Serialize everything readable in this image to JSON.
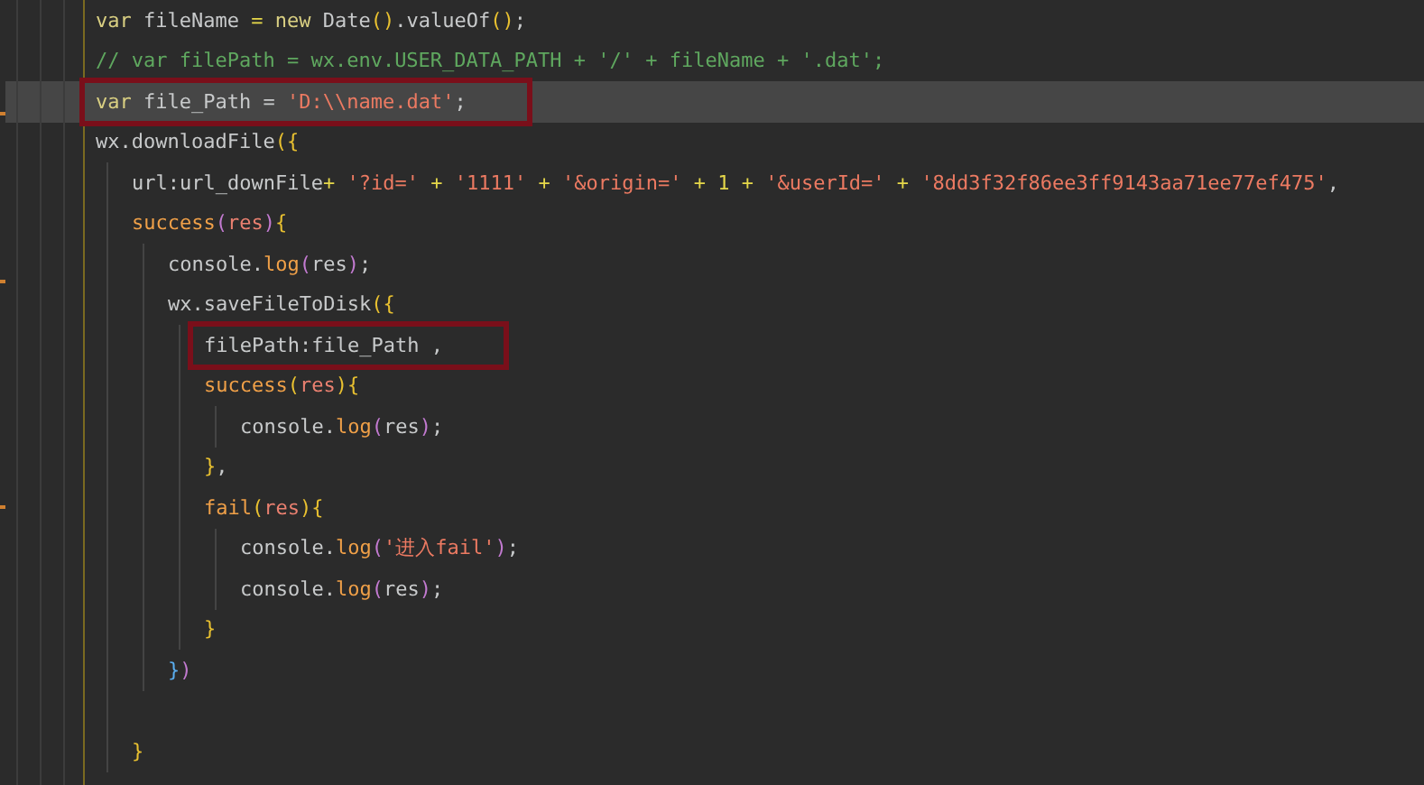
{
  "lines": [
    {
      "tokens": [
        {
          "kind": "kw",
          "text": "var "
        },
        {
          "kind": "id",
          "text": "fileName "
        },
        {
          "kind": "op",
          "text": "= "
        },
        {
          "kind": "kw",
          "text": "new "
        },
        {
          "kind": "id",
          "text": "Date"
        },
        {
          "kind": "b1",
          "text": "()"
        },
        {
          "kind": "id",
          "text": ".valueOf"
        },
        {
          "kind": "b1",
          "text": "()"
        },
        {
          "kind": "id",
          "text": ";"
        }
      ]
    },
    {
      "tokens": [
        {
          "kind": "com",
          "text": "// var filePath = wx.env.USER_DATA_PATH + '/' + fileName + '.dat';"
        }
      ]
    },
    {
      "selected": true,
      "annotated": true,
      "tokens": [
        {
          "kind": "kw",
          "text": "var "
        },
        {
          "kind": "id",
          "text": "file_Path = "
        },
        {
          "kind": "str",
          "text": "'D:\\\\name.dat'"
        },
        {
          "kind": "id",
          "text": ";"
        }
      ]
    },
    {
      "tokens": [
        {
          "kind": "id",
          "text": "wx.downloadFile"
        },
        {
          "kind": "b1",
          "text": "({"
        }
      ],
      "children": [
        {
          "tokens": [
            {
              "kind": "id",
              "text": "url:url_downFile"
            },
            {
              "kind": "op",
              "text": "+ "
            },
            {
              "kind": "str",
              "text": "'?id='"
            },
            {
              "kind": "op",
              "text": " + "
            },
            {
              "kind": "str",
              "text": "'1111'"
            },
            {
              "kind": "op",
              "text": " + "
            },
            {
              "kind": "str",
              "text": "'&origin='"
            },
            {
              "kind": "op",
              "text": " + "
            },
            {
              "kind": "num",
              "text": "1"
            },
            {
              "kind": "op",
              "text": " + "
            },
            {
              "kind": "str",
              "text": "'&userId='"
            },
            {
              "kind": "op",
              "text": " + "
            },
            {
              "kind": "str",
              "text": "'8dd3f32f86ee3ff9143aa71ee77ef475'"
            },
            {
              "kind": "id",
              "text": ","
            }
          ]
        },
        {
          "tokens": [
            {
              "kind": "fn",
              "text": "success"
            },
            {
              "kind": "b2",
              "text": "("
            },
            {
              "kind": "par",
              "text": "res"
            },
            {
              "kind": "b2",
              "text": ")"
            },
            {
              "kind": "b1",
              "text": "{"
            }
          ],
          "children": [
            {
              "tokens": [
                {
                  "kind": "id",
                  "text": "console."
                },
                {
                  "kind": "fn",
                  "text": "log"
                },
                {
                  "kind": "b2",
                  "text": "("
                },
                {
                  "kind": "id",
                  "text": "res"
                },
                {
                  "kind": "b2",
                  "text": ")"
                },
                {
                  "kind": "id",
                  "text": ";"
                }
              ]
            },
            {
              "tokens": [
                {
                  "kind": "id",
                  "text": "wx.saveFileToDisk"
                },
                {
                  "kind": "b1",
                  "text": "({"
                }
              ],
              "children": [
                {
                  "annotated": true,
                  "tokens": [
                    {
                      "kind": "id",
                      "text": "filePath:file_Path ,"
                    }
                  ]
                },
                {
                  "tokens": [
                    {
                      "kind": "fn",
                      "text": "success"
                    },
                    {
                      "kind": "b1",
                      "text": "("
                    },
                    {
                      "kind": "par",
                      "text": "res"
                    },
                    {
                      "kind": "b1",
                      "text": ")"
                    },
                    {
                      "kind": "b1",
                      "text": "{"
                    }
                  ],
                  "children": [
                    {
                      "tokens": [
                        {
                          "kind": "id",
                          "text": "console."
                        },
                        {
                          "kind": "fn",
                          "text": "log"
                        },
                        {
                          "kind": "b2",
                          "text": "("
                        },
                        {
                          "kind": "id",
                          "text": "res"
                        },
                        {
                          "kind": "b2",
                          "text": ")"
                        },
                        {
                          "kind": "id",
                          "text": ";"
                        }
                      ]
                    }
                  ]
                },
                {
                  "tokens": [
                    {
                      "kind": "b1",
                      "text": "}"
                    },
                    {
                      "kind": "id",
                      "text": ","
                    }
                  ]
                },
                {
                  "tokens": [
                    {
                      "kind": "fn",
                      "text": "fail"
                    },
                    {
                      "kind": "b1",
                      "text": "("
                    },
                    {
                      "kind": "par",
                      "text": "res"
                    },
                    {
                      "kind": "b1",
                      "text": ")"
                    },
                    {
                      "kind": "b1",
                      "text": "{"
                    }
                  ],
                  "children": [
                    {
                      "tokens": [
                        {
                          "kind": "id",
                          "text": "console."
                        },
                        {
                          "kind": "fn",
                          "text": "log"
                        },
                        {
                          "kind": "b2",
                          "text": "("
                        },
                        {
                          "kind": "str",
                          "text": "'进入fail'"
                        },
                        {
                          "kind": "b2",
                          "text": ")"
                        },
                        {
                          "kind": "id",
                          "text": ";"
                        }
                      ]
                    },
                    {
                      "tokens": [
                        {
                          "kind": "id",
                          "text": "console."
                        },
                        {
                          "kind": "fn",
                          "text": "log"
                        },
                        {
                          "kind": "b2",
                          "text": "("
                        },
                        {
                          "kind": "id",
                          "text": "res"
                        },
                        {
                          "kind": "b2",
                          "text": ")"
                        },
                        {
                          "kind": "id",
                          "text": ";"
                        }
                      ]
                    }
                  ]
                },
                {
                  "tokens": [
                    {
                      "kind": "b1",
                      "text": "}"
                    }
                  ]
                }
              ]
            },
            {
              "tokens": [
                {
                  "kind": "b3",
                  "text": "}"
                },
                {
                  "kind": "b2",
                  "text": ")"
                }
              ]
            }
          ]
        },
        {
          "tokens": [
            {
              "kind": "b1",
              "text": "}"
            }
          ]
        }
      ]
    }
  ]
}
